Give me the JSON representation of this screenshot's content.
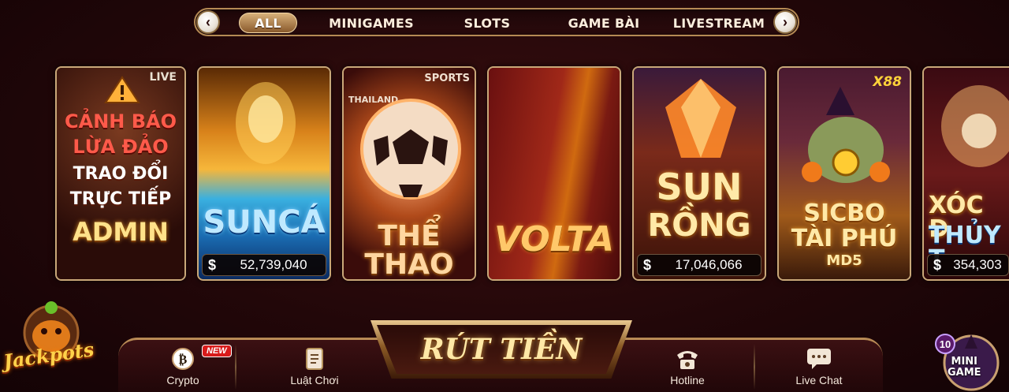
{
  "categories": {
    "prev": "‹",
    "next": "›",
    "tabs": [
      "ALL",
      "MINIGAMES",
      "SLOTS",
      "GAME BÀI",
      "LIVESTREAM"
    ],
    "active": "ALL"
  },
  "cards": {
    "warning": {
      "live": "LIVE",
      "line1": "CẢNH BÁO",
      "line2": "LỪA ĐẢO",
      "line3": "TRAO ĐỔI",
      "line4": "TRỰC TIẾP",
      "line5": "ADMIN"
    },
    "sunca": {
      "title": "SUNCÁ",
      "currency": "$",
      "jackpot": "52,739,040"
    },
    "thethao": {
      "title": "THỂ THAO",
      "sponsor": "SPORTS",
      "event": "THAILAND"
    },
    "volta": {
      "title": "VOLTA"
    },
    "sunrong": {
      "title1": "SUN",
      "title2": "RỒNG",
      "currency": "$",
      "jackpot": "17,046,066"
    },
    "sicbo": {
      "badge": "X88",
      "title1": "SICBO",
      "title2": "TÀI PHÚ",
      "title3": "MD5"
    },
    "xocdia": {
      "title1": "XÓC Đ",
      "title2": "THỦY T",
      "currency": "$",
      "jackpot": "354,303"
    }
  },
  "bottom": {
    "crypto": "Crypto",
    "new_badge": "NEW",
    "rules": "Luật Chơi",
    "withdraw": "RÚT TIỀN",
    "hotline": "Hotline",
    "livechat": "Live Chat"
  },
  "corner": {
    "jackpots": "Jackpots",
    "minigame_count": "10",
    "minigame_line1": "MINI",
    "minigame_line2": "GAME"
  }
}
